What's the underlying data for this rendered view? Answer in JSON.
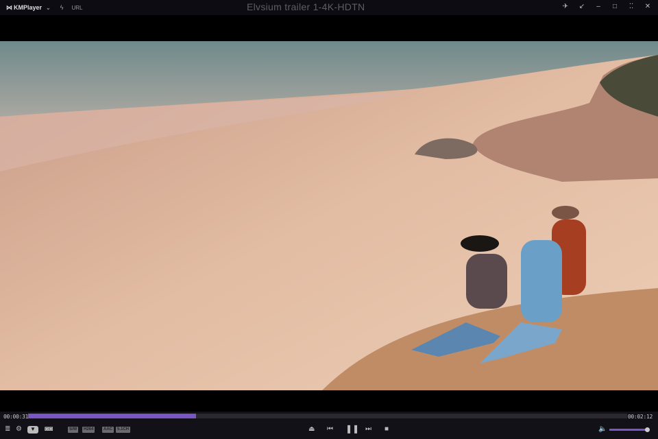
{
  "titlebar": {
    "app_name": "KMPlayer",
    "url_label": "URL",
    "title": "Elvsium trailer 1-4K-HDTN"
  },
  "playback": {
    "elapsed": "00:00:31",
    "total": "00:02:12",
    "progress_fraction": 0.28,
    "volume_fraction": 1.0
  },
  "badges": [
    "S/W",
    "H264",
    "AAC",
    "5.1CH"
  ],
  "colors": {
    "accent": "#7a55c4",
    "background": "#121118"
  }
}
